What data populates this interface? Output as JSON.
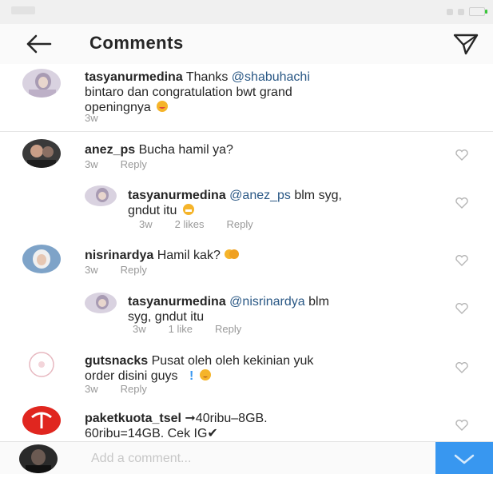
{
  "header": {
    "title": "Comments",
    "back_icon": "arrow-left-icon",
    "send_icon": "paper-plane-icon"
  },
  "caption": {
    "user": "tasyanurmedina",
    "text_before": " Thanks ",
    "mention": "@shabuhachi",
    "text_line2": "bintaro dan congratulation bwt grand",
    "text_line3": "openingnya",
    "time": "3w"
  },
  "comments": [
    {
      "user": "anez_ps",
      "text": " Bucha hamil ya?",
      "time": "3w",
      "reply_label": "Reply"
    },
    {
      "user": "tasyanurmedina",
      "mention": "@anez_ps",
      "text": " blm syg,",
      "text_line2": "gndut itu",
      "time": "3w",
      "likes": "2 likes",
      "reply_label": "Reply"
    },
    {
      "user": "nisrinardya",
      "text": " Hamil kak?",
      "time": "3w",
      "reply_label": "Reply"
    },
    {
      "user": "tasyanurmedina",
      "mention": "@nisrinardya",
      "text": " blm",
      "text_line2": "syg, gndut itu",
      "time": "3w",
      "likes": "1 like",
      "reply_label": "Reply"
    },
    {
      "user": "gutsnacks",
      "text": " Pusat oleh oleh kekinian yuk",
      "text_line2": "order disini guys",
      "time": "3w",
      "reply_label": "Reply"
    },
    {
      "user": "paketkuota_tsel",
      "text": " ➞40ribu–8GB.",
      "text_line2": "60ribu=14GB. Cek IG✔"
    }
  ],
  "composer": {
    "placeholder": "Add a comment...",
    "post_icon": "checkmark-icon"
  },
  "colors": {
    "mention": "#2a5885",
    "accent": "#3897f0",
    "meta": "#999999"
  }
}
